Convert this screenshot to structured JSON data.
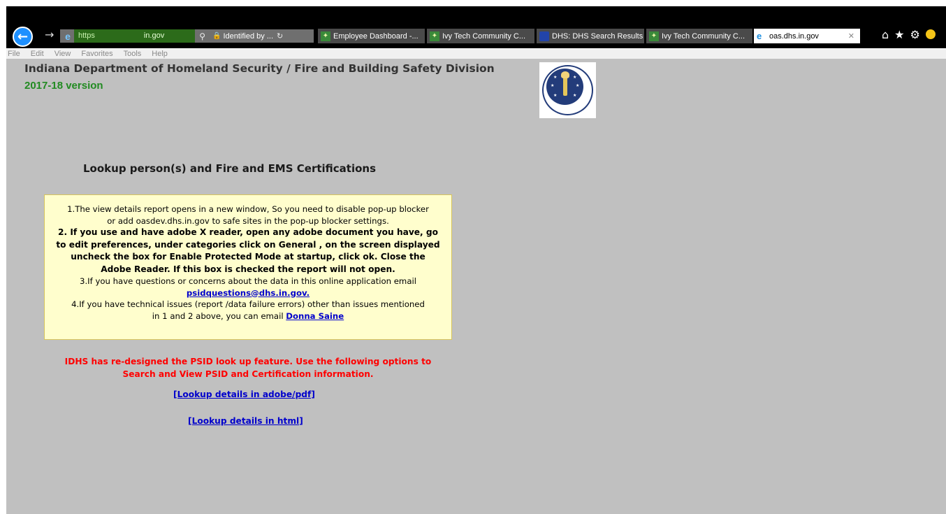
{
  "browser": {
    "address": {
      "scheme": "https",
      "domain": "in.gov",
      "identity": "Identified by ..."
    },
    "tabs": [
      {
        "label": "Employee Dashboard -..."
      },
      {
        "label": "Ivy Tech Community C..."
      },
      {
        "label": "DHS: DHS Search Results"
      },
      {
        "label": "Ivy Tech Community C..."
      },
      {
        "label": "oas.dhs.in.gov"
      }
    ],
    "menu": [
      "File",
      "Edit",
      "View",
      "Favorites",
      "Tools",
      "Help"
    ]
  },
  "page": {
    "title": "Indiana Department of Homeland Security / Fire and Building Safety Division",
    "version": "2017-18 version",
    "heading": "Lookup person(s) and Fire and EMS Certifications",
    "notice": {
      "line1a": "1.The view details report opens in a new window, So you need to disable pop-up blocker",
      "line1b": "or add oasdev.dhs.in.gov to safe sites in the pop-up blocker settings.",
      "line2a": "2. If you use and have adobe X reader, open any adobe document you have, go",
      "line2b": "to edit preferences, under categories click on General , on the screen displayed",
      "line2c": "uncheck the box for Enable Protected Mode at startup, click ok. Close the",
      "line2d": "Adobe Reader. If this box is checked the report will not open.",
      "line3": "3.If you have questions or concerns about the data in this online application email",
      "email": "psidquestions@dhs.in.gov.",
      "line4a": "4.If you have technical issues (report /data failure errors) other than issues mentioned",
      "line4b": "in 1 and 2 above, you can email",
      "contact": "Donna Saine"
    },
    "redesign_line1": "IDHS has re-designed the PSID look up feature. Use the following options to",
    "redesign_line2": "Search and View PSID and Certification information.",
    "link_pdf": "[Lookup details in adobe/pdf]",
    "link_html": "[Lookup details in html]"
  }
}
